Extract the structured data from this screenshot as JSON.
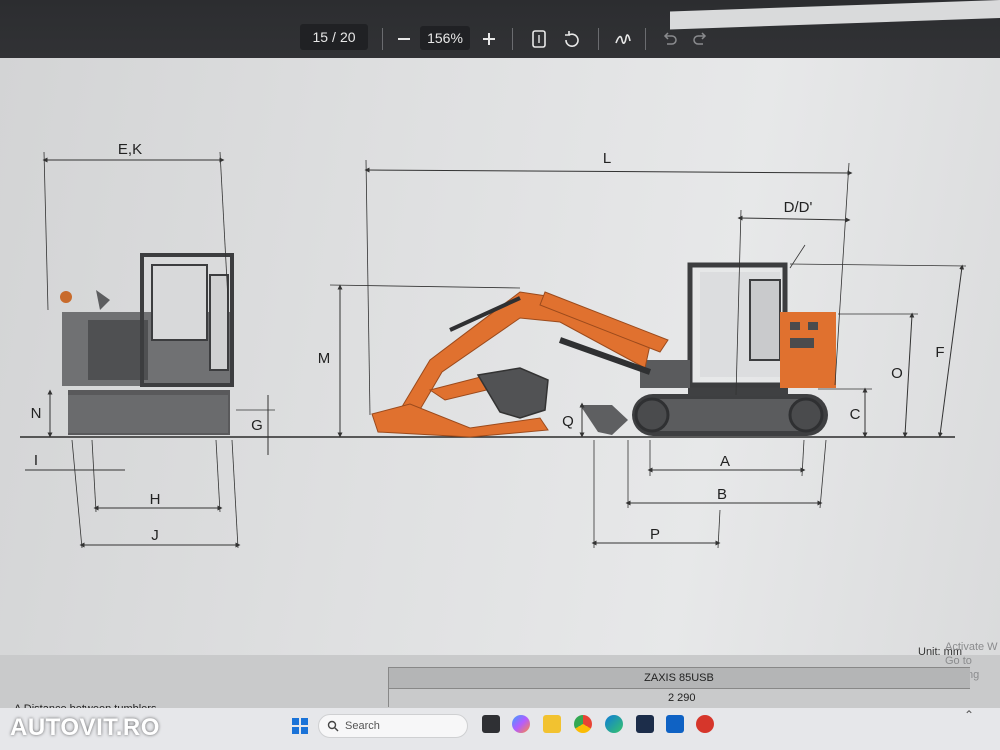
{
  "viewer": {
    "page_current": "15",
    "page_separator": "/",
    "page_total": "20",
    "zoom": "156%",
    "zoom_out_icon": "minus-icon",
    "zoom_in_icon": "plus-icon",
    "icons": [
      "fit-page-icon",
      "rotate-icon",
      "draw-icon",
      "undo-icon",
      "redo-icon"
    ]
  },
  "drawing": {
    "dims": {
      "ek": "E,K",
      "l": "L",
      "dd": "D/D'",
      "m": "M",
      "n": "N",
      "g": "G",
      "i": "I",
      "h": "H",
      "j": "J",
      "q": "Q",
      "c": "C",
      "o": "O",
      "f": "F",
      "a": "A",
      "b": "B",
      "p": "P"
    },
    "colors": {
      "boom": "#e0712f",
      "body": "#6a6b6d",
      "track": "#4a4b4d"
    }
  },
  "document": {
    "unit": "Unit: mm",
    "watermark_line1": "Activate W",
    "watermark_line2": "Go to Setting",
    "model": "ZAXIS 85USB",
    "row_a_label": "A   Distance between tumblers",
    "row_a_value": "2 290"
  },
  "taskbar": {
    "logo": "AUTOVIT.RO",
    "search_placeholder": "Search",
    "start_icon": "windows-icon",
    "search_icon": "search-icon",
    "apps": [
      "task-view-icon",
      "copilot-icon",
      "file-explorer-icon",
      "chrome-icon",
      "edge-icon",
      "store-icon",
      "outlook-icon",
      "office-icon"
    ]
  }
}
